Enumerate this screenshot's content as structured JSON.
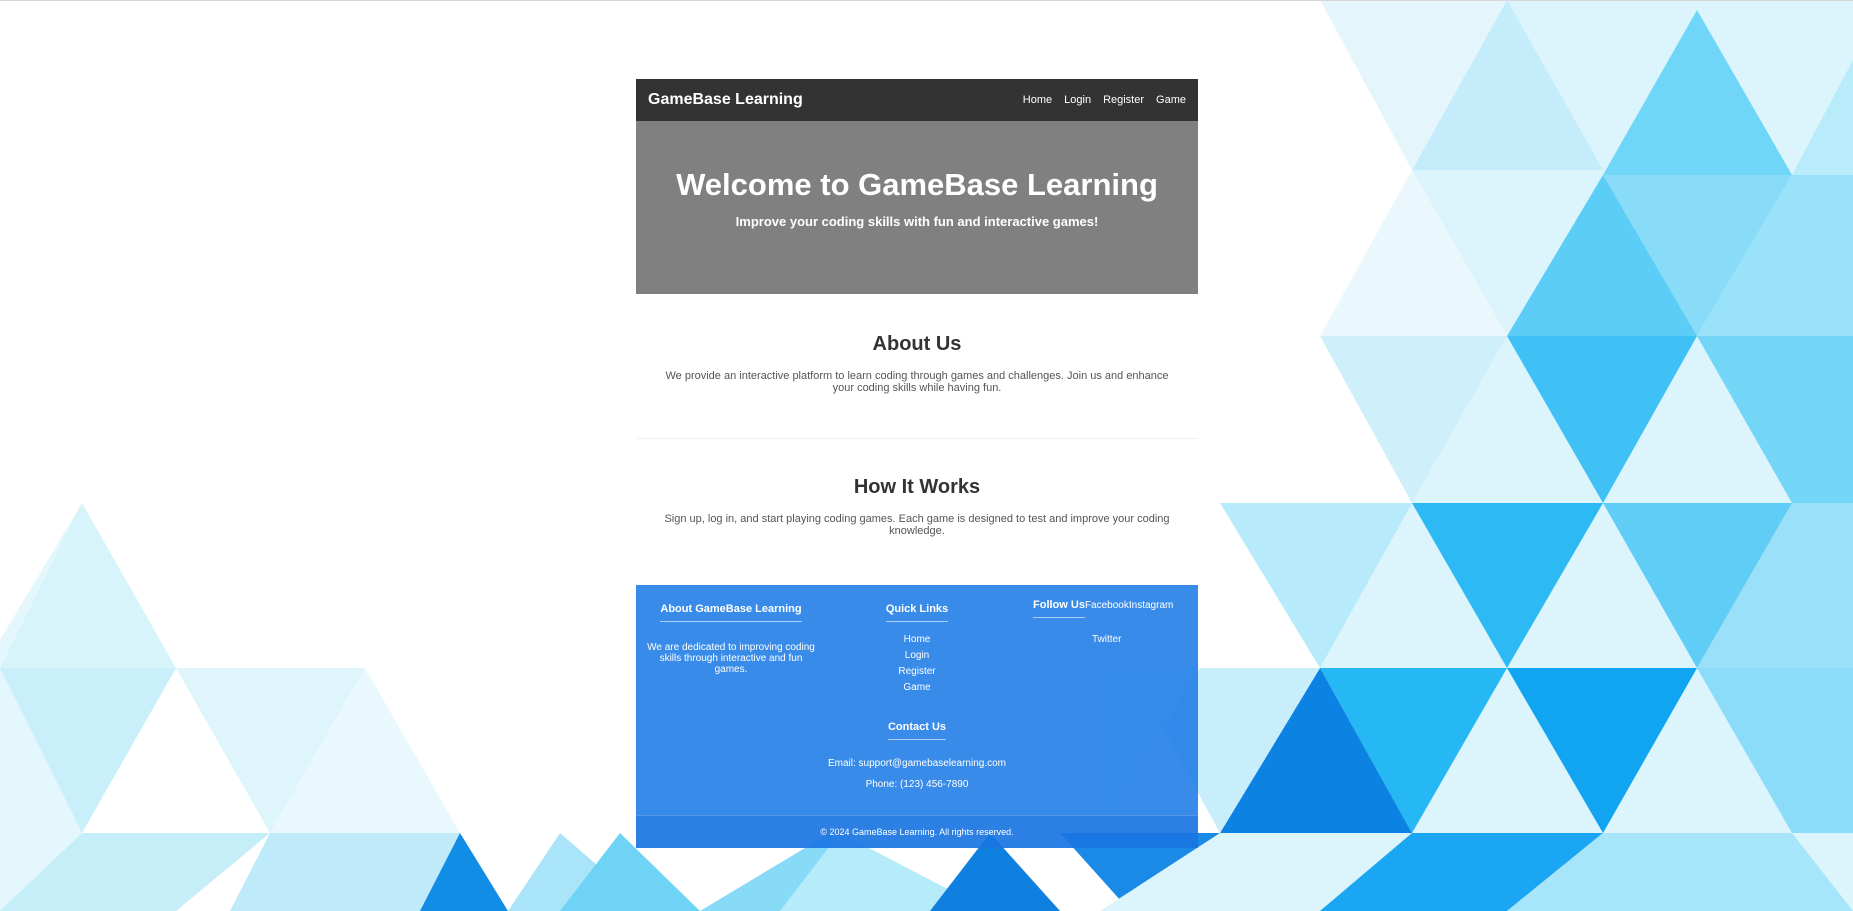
{
  "navbar": {
    "brand": "GameBase Learning",
    "links": [
      "Home",
      "Login",
      "Register",
      "Game"
    ]
  },
  "hero": {
    "title": "Welcome to GameBase Learning",
    "subtitle": "Improve your coding skills with fun and interactive games!"
  },
  "about": {
    "heading": "About Us",
    "text": "We provide an interactive platform to learn coding through games and challenges. Join us and enhance your coding skills while having fun."
  },
  "how": {
    "heading": "How It Works",
    "text": "Sign up, log in, and start playing coding games. Each game is designed to test and improve your coding knowledge."
  },
  "footer": {
    "about_heading": "About GameBase Learning",
    "about_text": "We are dedicated to improving coding skills through interactive and fun games.",
    "links_heading": "Quick Links",
    "links": [
      "Home",
      "Login",
      "Register",
      "Game"
    ],
    "follow_heading": "Follow Us",
    "social": [
      "Facebook",
      "Instagram",
      "Twitter"
    ],
    "contact_heading": "Contact Us",
    "email": "Email: support@gamebaselearning.com",
    "phone": "Phone: (123) 456-7890",
    "copyright": "© 2024 GameBase Learning. All rights reserved."
  },
  "colors": {
    "navbar": "#333333",
    "hero": "#808080",
    "footer": "#1e7be6",
    "background_accent": "#3fc1f5"
  }
}
